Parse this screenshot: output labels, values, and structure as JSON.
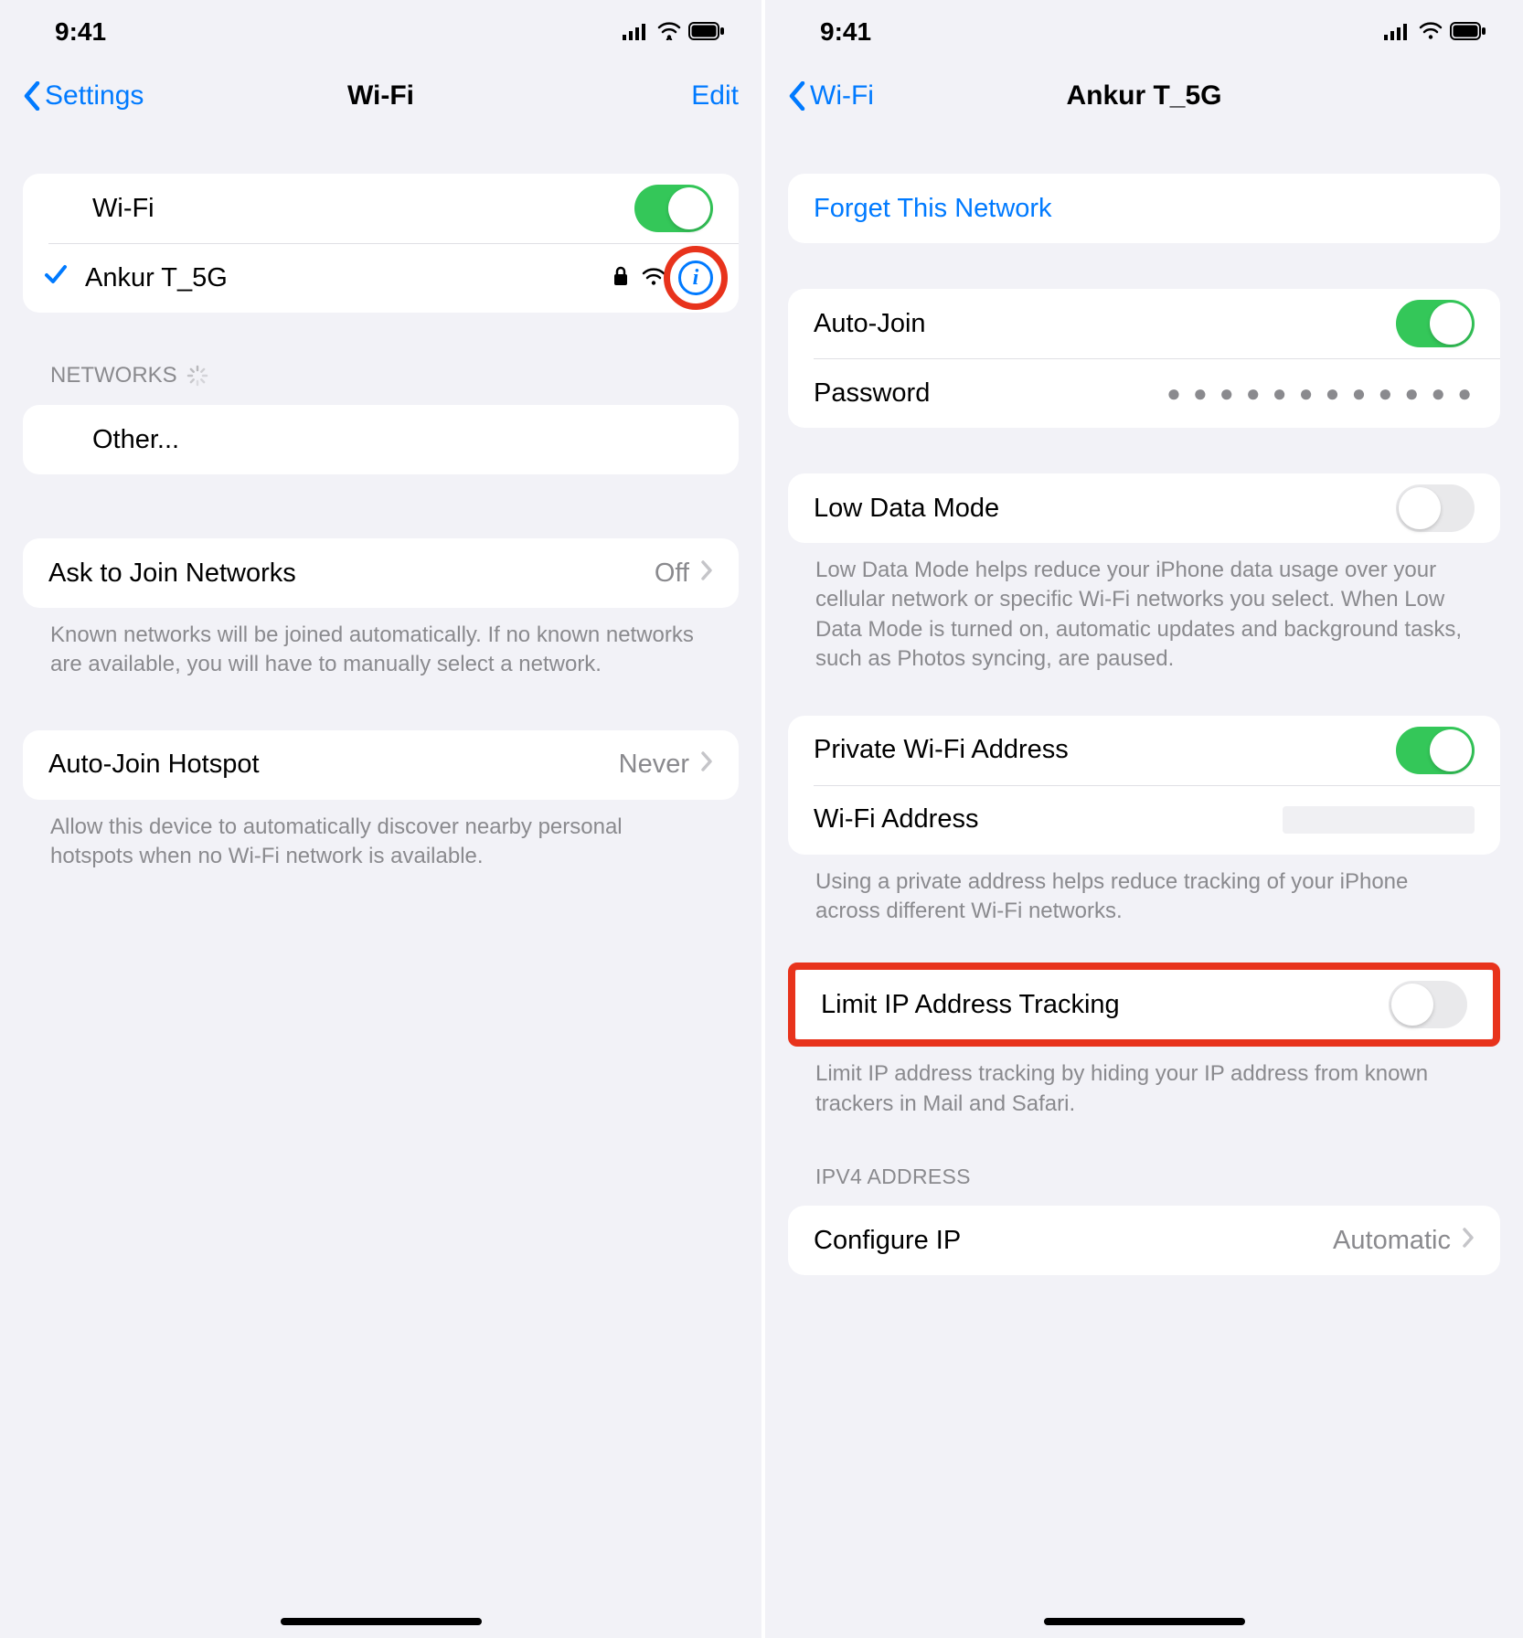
{
  "status": {
    "time": "9:41"
  },
  "left": {
    "nav": {
      "back": "Settings",
      "title": "Wi-Fi",
      "edit": "Edit"
    },
    "wifiRow": {
      "label": "Wi-Fi"
    },
    "network": {
      "name": "Ankur T_5G"
    },
    "networksHeader": "NETWORKS",
    "other": "Other...",
    "ask": {
      "label": "Ask to Join Networks",
      "value": "Off"
    },
    "askFooter": "Known networks will be joined automatically. If no known networks are available, you will have to manually select a network.",
    "hotspot": {
      "label": "Auto-Join Hotspot",
      "value": "Never"
    },
    "hotspotFooter": "Allow this device to automatically discover nearby personal hotspots when no Wi-Fi network is available."
  },
  "right": {
    "nav": {
      "back": "Wi-Fi",
      "title": "Ankur T_5G"
    },
    "forget": "Forget This Network",
    "autojoin": "Auto-Join",
    "password": {
      "label": "Password",
      "value": "● ● ● ● ● ● ● ● ● ● ● ●"
    },
    "lowdata": "Low Data Mode",
    "lowdataFooter": "Low Data Mode helps reduce your iPhone data usage over your cellular network or specific Wi-Fi networks you select. When Low Data Mode is turned on, automatic updates and background tasks, such as Photos syncing, are paused.",
    "privateAddr": "Private Wi-Fi Address",
    "wifiAddr": "Wi-Fi Address",
    "privateFooter": "Using a private address helps reduce tracking of your iPhone across different Wi-Fi networks.",
    "limit": "Limit IP Address Tracking",
    "limitFooter": "Limit IP address tracking by hiding your IP address from known trackers in Mail and Safari.",
    "ipv4Header": "IPV4 ADDRESS",
    "configIP": {
      "label": "Configure IP",
      "value": "Automatic"
    }
  }
}
